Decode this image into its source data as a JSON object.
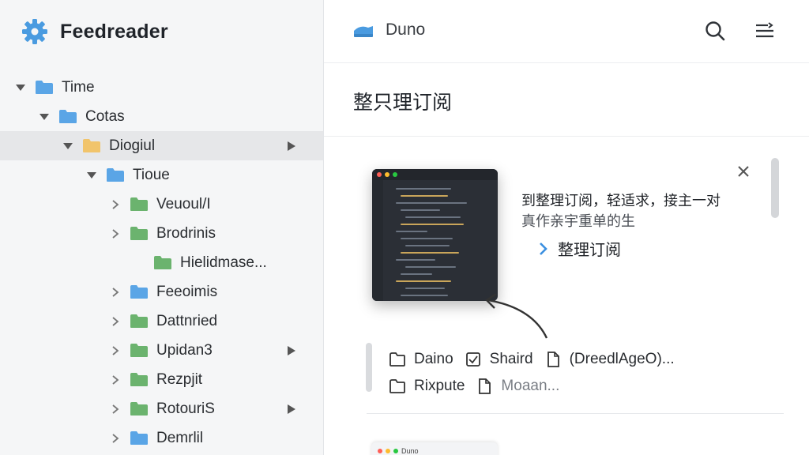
{
  "app": {
    "name": "Feedreader",
    "accent": "#4a9be0"
  },
  "tree": [
    {
      "label": "Time",
      "level": 0,
      "expanded": true,
      "color": "#5aa5e6",
      "arrow": false
    },
    {
      "label": "Cotas",
      "level": 1,
      "expanded": true,
      "color": "#5aa5e6",
      "arrow": false
    },
    {
      "label": "Diogiul",
      "level": 2,
      "expanded": true,
      "color": "#f1c46b",
      "arrow": true,
      "selected": true
    },
    {
      "label": "Tioue",
      "level": 3,
      "expanded": true,
      "color": "#5aa5e6",
      "arrow": false
    },
    {
      "label": "Veuoul/I",
      "level": 4,
      "expanded": false,
      "color": "#6bb36e",
      "arrow": false
    },
    {
      "label": "Brodrinis",
      "level": 4,
      "expanded": false,
      "color": "#6bb36e",
      "arrow": false
    },
    {
      "label": "Hielidmase...",
      "level": 5,
      "expanded": null,
      "color": "#6bb36e",
      "arrow": false
    },
    {
      "label": "Feeoimis",
      "level": 4,
      "expanded": false,
      "color": "#5aa5e6",
      "arrow": false
    },
    {
      "label": "Dattnried",
      "level": 4,
      "expanded": false,
      "color": "#6bb36e",
      "arrow": false
    },
    {
      "label": "Upidan3",
      "level": 4,
      "expanded": false,
      "color": "#6bb36e",
      "arrow": true
    },
    {
      "label": "Rezpjit",
      "level": 4,
      "expanded": false,
      "color": "#6bb36e",
      "arrow": false
    },
    {
      "label": "RotouriS",
      "level": 4,
      "expanded": false,
      "color": "#6bb36e",
      "arrow": true
    },
    {
      "label": "Demrlil",
      "level": 4,
      "expanded": false,
      "color": "#5aa5e6",
      "arrow": false
    }
  ],
  "topbar": {
    "title": "Duno"
  },
  "section": {
    "title": "整只理订阅"
  },
  "card": {
    "description_line1": "到整理订阅，轻适求，接主一对",
    "description_line2": "真作亲宇重单的生",
    "link_label": "整理订阅",
    "files": [
      [
        {
          "icon": "folder",
          "label": "Daino"
        },
        {
          "icon": "check-square",
          "label": "Shaird"
        },
        {
          "icon": "file",
          "label": "(DreedlAgeO)..."
        }
      ],
      [
        {
          "icon": "folder",
          "label": "Rixpute"
        },
        {
          "icon": "file",
          "label": "Moaan..."
        }
      ]
    ]
  },
  "card2": {
    "title": "Duno"
  }
}
